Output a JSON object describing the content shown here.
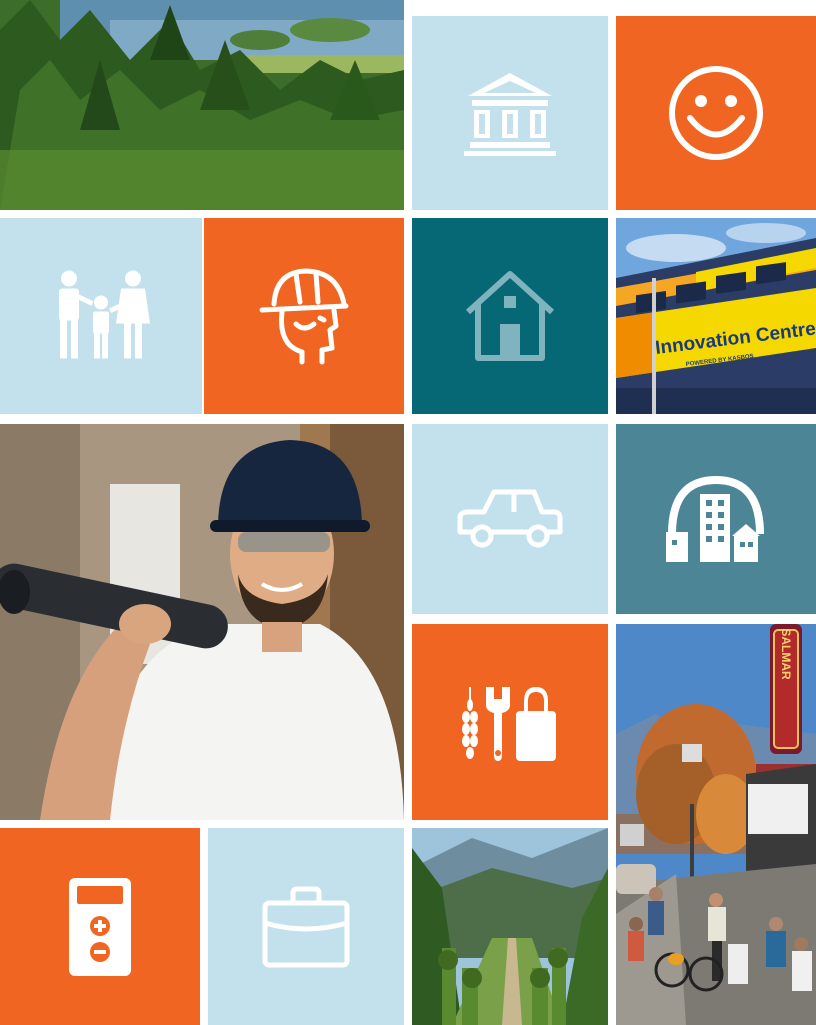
{
  "tiles": {
    "lake_photo": {
      "kind": "photo",
      "subject": "lake-forest"
    },
    "government": {
      "icon": "government-building-icon",
      "color": "#c2e1ec"
    },
    "happiness": {
      "icon": "smiley-face-icon",
      "color": "#f06521"
    },
    "family": {
      "icon": "family-icon",
      "color": "#c2e1ec"
    },
    "worker": {
      "icon": "hard-hat-worker-icon",
      "color": "#f06521"
    },
    "housing": {
      "icon": "house-icon",
      "color": "#056874"
    },
    "innovation_photo": {
      "kind": "photo",
      "sign_text": "Innovation Centre",
      "sign_subtext": "POWERED BY KASBOS"
    },
    "worker_photo": {
      "kind": "photo",
      "subject": "smiling-worker-with-hard-hat"
    },
    "transport": {
      "icon": "car-icon",
      "color": "#c2e1ec"
    },
    "community": {
      "icon": "city-skyline-icon",
      "color": "#4c8696"
    },
    "industries": {
      "icon": "agriculture-tools-retail-icon",
      "color": "#f06521"
    },
    "street_photo": {
      "kind": "photo",
      "sign_text": "SALMAR"
    },
    "cost": {
      "icon": "calculator-icon",
      "color": "#f06521"
    },
    "business": {
      "icon": "briefcase-icon",
      "color": "#c2e1ec"
    },
    "vineyard_photo": {
      "kind": "photo",
      "subject": "vineyard-mountains"
    }
  }
}
